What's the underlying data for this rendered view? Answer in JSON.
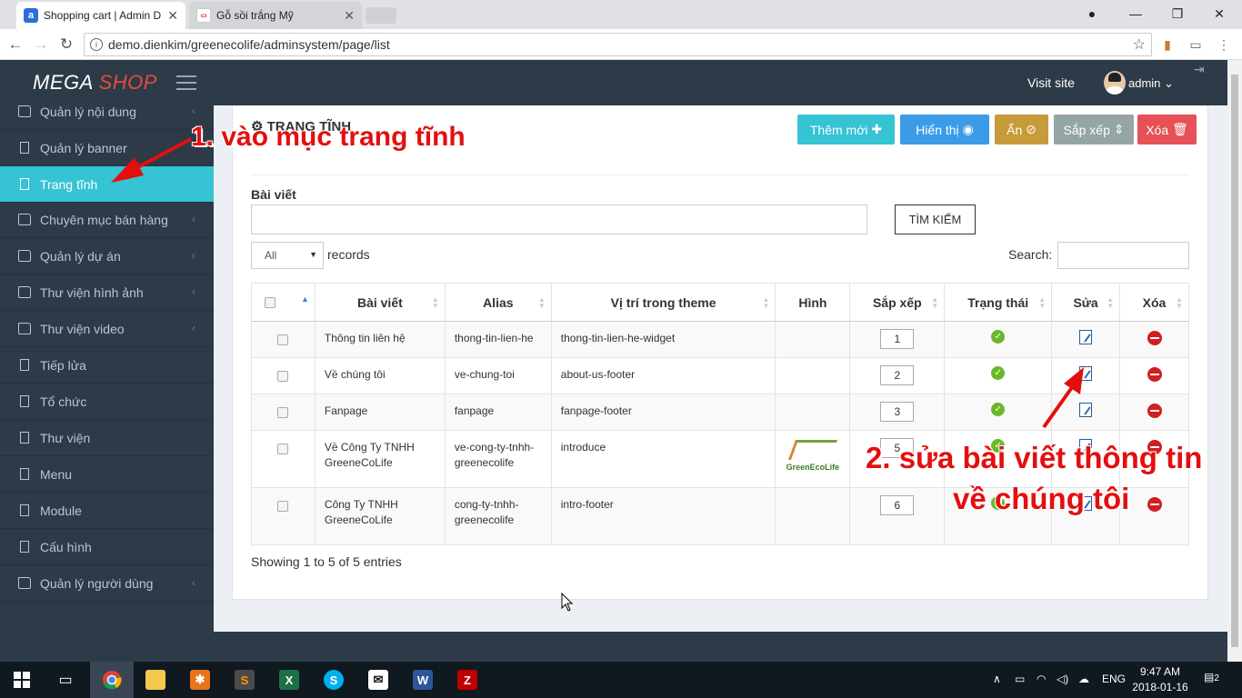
{
  "browser": {
    "tabs": [
      {
        "title": "Shopping cart | Admin D",
        "active": true
      },
      {
        "title": "Gỗ sồi trắng Mỹ",
        "active": false
      }
    ],
    "url": "demo.dienkim/greenecolife/adminsystem/page/list"
  },
  "header": {
    "logo_main": "MEGA",
    "logo_accent": "SHOP",
    "visit_site": "Visit site",
    "user": "admin"
  },
  "sidebar": {
    "items": [
      {
        "label": "Quản lý nội dung",
        "icon": "folder-icon",
        "has_children": true
      },
      {
        "label": "Quản lý banner",
        "icon": "page-icon",
        "has_children": false
      },
      {
        "label": "Trang tĩnh",
        "icon": "page-icon",
        "has_children": false,
        "active": true
      },
      {
        "label": "Chuyên mục bán hàng",
        "icon": "folder-icon",
        "has_children": true
      },
      {
        "label": "Quản lý dự án",
        "icon": "folder-icon",
        "has_children": true
      },
      {
        "label": "Thư viện hình ảnh",
        "icon": "folder-icon",
        "has_children": true
      },
      {
        "label": "Thư viện video",
        "icon": "folder-icon",
        "has_children": true
      },
      {
        "label": "Tiếp lửa",
        "icon": "page-icon",
        "has_children": false
      },
      {
        "label": "Tổ chức",
        "icon": "page-icon",
        "has_children": false
      },
      {
        "label": "Thư viện",
        "icon": "page-icon",
        "has_children": false
      },
      {
        "label": "Menu",
        "icon": "page-icon",
        "has_children": false
      },
      {
        "label": "Module",
        "icon": "page-icon",
        "has_children": false
      },
      {
        "label": "Cấu hình",
        "icon": "page-icon",
        "has_children": false
      },
      {
        "label": "Quản lý người dùng",
        "icon": "folder-icon",
        "has_children": true
      }
    ]
  },
  "main": {
    "title": "TRANG TĨNH",
    "buttons": {
      "add": "Thêm mới",
      "show": "Hiển thị",
      "hide": "Ẩn",
      "sort": "Sắp xếp",
      "delete": "Xóa"
    },
    "button_colors": {
      "add": "#36c3d3",
      "show": "#3c9be6",
      "hide": "#c79a3a",
      "sort": "#95a5a6",
      "delete": "#e55157"
    },
    "search_label": "Bài viết",
    "search_button": "TÌM KIẾM",
    "records_select": "All",
    "records_label": "records",
    "table_search_label": "Search:",
    "columns": [
      "Bài viết",
      "Alias",
      "Vị trí trong theme",
      "Hình",
      "Sắp xếp",
      "Trạng thái",
      "Sửa",
      "Xóa"
    ],
    "rows": [
      {
        "title": "Thông tin liên hệ",
        "alias": "thong-tin-lien-he",
        "position": "thong-tin-lien-he-widget",
        "image": "",
        "order": "1",
        "status": "active"
      },
      {
        "title": "Về chúng tôi",
        "alias": "ve-chung-toi",
        "position": "about-us-footer",
        "image": "",
        "order": "2",
        "status": "active"
      },
      {
        "title": "Fanpage",
        "alias": "fanpage",
        "position": "fanpage-footer",
        "image": "",
        "order": "3",
        "status": "active"
      },
      {
        "title": "Về Công Ty TNHH GreeneCoLife",
        "alias": "ve-cong-ty-tnhh-greenecolife",
        "position": "introduce",
        "image": "GreenEcoLife",
        "order": "5",
        "status": "active"
      },
      {
        "title": "Công Ty TNHH GreeneCoLife",
        "alias": "cong-ty-tnhh-greenecolife",
        "position": "intro-footer",
        "image": "",
        "order": "6",
        "status": "active"
      }
    ],
    "footer_text": "Showing 1 to 5 of 5 entries"
  },
  "annotations": {
    "step1": "1. vào mục trang tĩnh",
    "step2_line1": "2. sửa bài viết thông tin",
    "step2_line2": "về chúng tôi"
  },
  "taskbar": {
    "language": "ENG",
    "time": "9:47 AM",
    "date": "2018-01-16",
    "notifications": "2"
  }
}
